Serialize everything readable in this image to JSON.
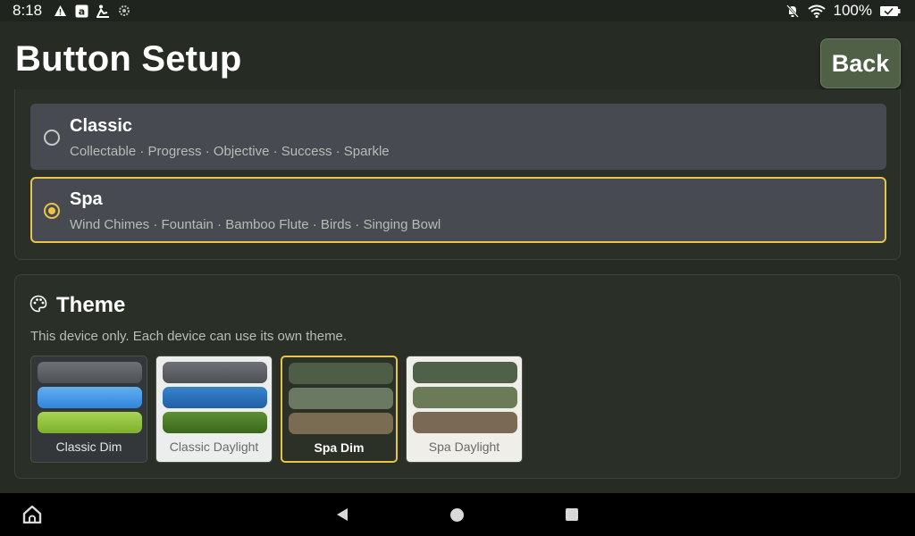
{
  "status_bar": {
    "time": "8:18",
    "left_icons": [
      "warning-icon",
      "amazon-icon",
      "accessibility-icon",
      "settings-icon"
    ],
    "right_icons": [
      "notifications-off-icon",
      "wifi-icon",
      "battery-icon"
    ],
    "battery_text": "100%"
  },
  "header": {
    "title": "Button Setup",
    "back_label": "Back"
  },
  "sound_packs": {
    "options": [
      {
        "name": "Classic",
        "description": "Collectable · Progress · Objective · Success · Sparkle",
        "selected": false
      },
      {
        "name": "Spa",
        "description": "Wind Chimes · Fountain · Bamboo Flute · Birds · Singing Bowl",
        "selected": true
      }
    ]
  },
  "theme": {
    "icon": "palette-icon",
    "title": "Theme",
    "subtitle": "This device only. Each device can use its own theme.",
    "tiles": [
      {
        "label": "Classic Dim",
        "selected": false,
        "swatches": [
          "#5b5e63",
          "#3f8fe0",
          "#8fbf3a"
        ],
        "background": "#33373a"
      },
      {
        "label": "Classic Daylight",
        "selected": false,
        "swatches": [
          "#5b5e63",
          "#2a6fb8",
          "#4a7a26"
        ],
        "background": "#eceeee"
      },
      {
        "label": "Spa Dim",
        "selected": true,
        "swatches": [
          "#4f6046",
          "#6c7a62",
          "#7a6a52"
        ],
        "background": "#2b3127"
      },
      {
        "label": "Spa Daylight",
        "selected": false,
        "swatches": [
          "#4f6046",
          "#6c7a58",
          "#7a6a55"
        ],
        "background": "#efeee9"
      }
    ]
  },
  "nav_bar": {
    "icons": [
      "home-icon",
      "back-triangle-icon",
      "home-circle-icon",
      "recents-square-icon"
    ]
  },
  "colors": {
    "accent": "#e8c44a",
    "background": "#262c24",
    "panel": "#2a3028",
    "option": "#474a50",
    "back_button": "#4f6046"
  }
}
